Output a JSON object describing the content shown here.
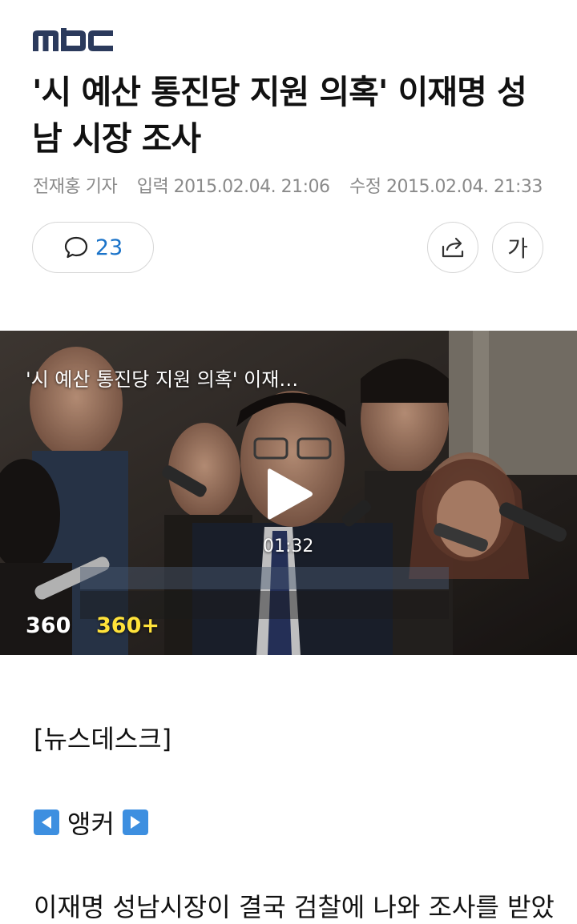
{
  "brand": {
    "logo_text": "MBC"
  },
  "article": {
    "title": "'시 예산 통진당 지원 의혹' 이재명 성남 시장 조사",
    "reporter": "전재홍 기자",
    "published": "입력 2015.02.04. 21:06",
    "modified": "수정 2015.02.04. 21:33"
  },
  "actions": {
    "comment_count": "23",
    "font_label": "가",
    "icons": [
      "comment-icon",
      "share-icon"
    ]
  },
  "video": {
    "title": "'시 예산 통진당 지원 의혹' 이재…",
    "duration": "01:32",
    "badge_360": "360",
    "badge_360_plus": "360+",
    "badge_color": "#ffe23a"
  },
  "body": {
    "section": "[뉴스데스크]",
    "anchor_label": "앵커",
    "first_line": "이재명 성남시장이 결국 검찰에 나와 조사를 받았"
  },
  "colors": {
    "accent": "#1a73c9",
    "logo": "#2b3a5c"
  }
}
